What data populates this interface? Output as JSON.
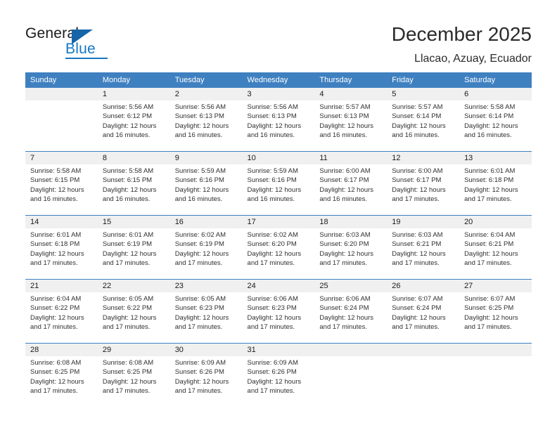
{
  "brand": {
    "name_part1": "General",
    "name_part2": "Blue",
    "flag_color": "#1565a8",
    "accent_color": "#1577c4"
  },
  "header": {
    "title": "December 2025",
    "subtitle": "Llacao, Azuay, Ecuador"
  },
  "calendar": {
    "header_bg": "#3f80c0",
    "numbers_row_bg": "#f0f0f0",
    "weekdays": [
      "Sunday",
      "Monday",
      "Tuesday",
      "Wednesday",
      "Thursday",
      "Friday",
      "Saturday"
    ],
    "weeks": [
      [
        {
          "day": "",
          "sunrise": "",
          "sunset": "",
          "daylight1": "",
          "daylight2": ""
        },
        {
          "day": "1",
          "sunrise": "Sunrise: 5:56 AM",
          "sunset": "Sunset: 6:12 PM",
          "daylight1": "Daylight: 12 hours",
          "daylight2": "and 16 minutes."
        },
        {
          "day": "2",
          "sunrise": "Sunrise: 5:56 AM",
          "sunset": "Sunset: 6:13 PM",
          "daylight1": "Daylight: 12 hours",
          "daylight2": "and 16 minutes."
        },
        {
          "day": "3",
          "sunrise": "Sunrise: 5:56 AM",
          "sunset": "Sunset: 6:13 PM",
          "daylight1": "Daylight: 12 hours",
          "daylight2": "and 16 minutes."
        },
        {
          "day": "4",
          "sunrise": "Sunrise: 5:57 AM",
          "sunset": "Sunset: 6:13 PM",
          "daylight1": "Daylight: 12 hours",
          "daylight2": "and 16 minutes."
        },
        {
          "day": "5",
          "sunrise": "Sunrise: 5:57 AM",
          "sunset": "Sunset: 6:14 PM",
          "daylight1": "Daylight: 12 hours",
          "daylight2": "and 16 minutes."
        },
        {
          "day": "6",
          "sunrise": "Sunrise: 5:58 AM",
          "sunset": "Sunset: 6:14 PM",
          "daylight1": "Daylight: 12 hours",
          "daylight2": "and 16 minutes."
        }
      ],
      [
        {
          "day": "7",
          "sunrise": "Sunrise: 5:58 AM",
          "sunset": "Sunset: 6:15 PM",
          "daylight1": "Daylight: 12 hours",
          "daylight2": "and 16 minutes."
        },
        {
          "day": "8",
          "sunrise": "Sunrise: 5:58 AM",
          "sunset": "Sunset: 6:15 PM",
          "daylight1": "Daylight: 12 hours",
          "daylight2": "and 16 minutes."
        },
        {
          "day": "9",
          "sunrise": "Sunrise: 5:59 AM",
          "sunset": "Sunset: 6:16 PM",
          "daylight1": "Daylight: 12 hours",
          "daylight2": "and 16 minutes."
        },
        {
          "day": "10",
          "sunrise": "Sunrise: 5:59 AM",
          "sunset": "Sunset: 6:16 PM",
          "daylight1": "Daylight: 12 hours",
          "daylight2": "and 16 minutes."
        },
        {
          "day": "11",
          "sunrise": "Sunrise: 6:00 AM",
          "sunset": "Sunset: 6:17 PM",
          "daylight1": "Daylight: 12 hours",
          "daylight2": "and 16 minutes."
        },
        {
          "day": "12",
          "sunrise": "Sunrise: 6:00 AM",
          "sunset": "Sunset: 6:17 PM",
          "daylight1": "Daylight: 12 hours",
          "daylight2": "and 17 minutes."
        },
        {
          "day": "13",
          "sunrise": "Sunrise: 6:01 AM",
          "sunset": "Sunset: 6:18 PM",
          "daylight1": "Daylight: 12 hours",
          "daylight2": "and 17 minutes."
        }
      ],
      [
        {
          "day": "14",
          "sunrise": "Sunrise: 6:01 AM",
          "sunset": "Sunset: 6:18 PM",
          "daylight1": "Daylight: 12 hours",
          "daylight2": "and 17 minutes."
        },
        {
          "day": "15",
          "sunrise": "Sunrise: 6:01 AM",
          "sunset": "Sunset: 6:19 PM",
          "daylight1": "Daylight: 12 hours",
          "daylight2": "and 17 minutes."
        },
        {
          "day": "16",
          "sunrise": "Sunrise: 6:02 AM",
          "sunset": "Sunset: 6:19 PM",
          "daylight1": "Daylight: 12 hours",
          "daylight2": "and 17 minutes."
        },
        {
          "day": "17",
          "sunrise": "Sunrise: 6:02 AM",
          "sunset": "Sunset: 6:20 PM",
          "daylight1": "Daylight: 12 hours",
          "daylight2": "and 17 minutes."
        },
        {
          "day": "18",
          "sunrise": "Sunrise: 6:03 AM",
          "sunset": "Sunset: 6:20 PM",
          "daylight1": "Daylight: 12 hours",
          "daylight2": "and 17 minutes."
        },
        {
          "day": "19",
          "sunrise": "Sunrise: 6:03 AM",
          "sunset": "Sunset: 6:21 PM",
          "daylight1": "Daylight: 12 hours",
          "daylight2": "and 17 minutes."
        },
        {
          "day": "20",
          "sunrise": "Sunrise: 6:04 AM",
          "sunset": "Sunset: 6:21 PM",
          "daylight1": "Daylight: 12 hours",
          "daylight2": "and 17 minutes."
        }
      ],
      [
        {
          "day": "21",
          "sunrise": "Sunrise: 6:04 AM",
          "sunset": "Sunset: 6:22 PM",
          "daylight1": "Daylight: 12 hours",
          "daylight2": "and 17 minutes."
        },
        {
          "day": "22",
          "sunrise": "Sunrise: 6:05 AM",
          "sunset": "Sunset: 6:22 PM",
          "daylight1": "Daylight: 12 hours",
          "daylight2": "and 17 minutes."
        },
        {
          "day": "23",
          "sunrise": "Sunrise: 6:05 AM",
          "sunset": "Sunset: 6:23 PM",
          "daylight1": "Daylight: 12 hours",
          "daylight2": "and 17 minutes."
        },
        {
          "day": "24",
          "sunrise": "Sunrise: 6:06 AM",
          "sunset": "Sunset: 6:23 PM",
          "daylight1": "Daylight: 12 hours",
          "daylight2": "and 17 minutes."
        },
        {
          "day": "25",
          "sunrise": "Sunrise: 6:06 AM",
          "sunset": "Sunset: 6:24 PM",
          "daylight1": "Daylight: 12 hours",
          "daylight2": "and 17 minutes."
        },
        {
          "day": "26",
          "sunrise": "Sunrise: 6:07 AM",
          "sunset": "Sunset: 6:24 PM",
          "daylight1": "Daylight: 12 hours",
          "daylight2": "and 17 minutes."
        },
        {
          "day": "27",
          "sunrise": "Sunrise: 6:07 AM",
          "sunset": "Sunset: 6:25 PM",
          "daylight1": "Daylight: 12 hours",
          "daylight2": "and 17 minutes."
        }
      ],
      [
        {
          "day": "28",
          "sunrise": "Sunrise: 6:08 AM",
          "sunset": "Sunset: 6:25 PM",
          "daylight1": "Daylight: 12 hours",
          "daylight2": "and 17 minutes."
        },
        {
          "day": "29",
          "sunrise": "Sunrise: 6:08 AM",
          "sunset": "Sunset: 6:25 PM",
          "daylight1": "Daylight: 12 hours",
          "daylight2": "and 17 minutes."
        },
        {
          "day": "30",
          "sunrise": "Sunrise: 6:09 AM",
          "sunset": "Sunset: 6:26 PM",
          "daylight1": "Daylight: 12 hours",
          "daylight2": "and 17 minutes."
        },
        {
          "day": "31",
          "sunrise": "Sunrise: 6:09 AM",
          "sunset": "Sunset: 6:26 PM",
          "daylight1": "Daylight: 12 hours",
          "daylight2": "and 17 minutes."
        },
        {
          "day": "",
          "sunrise": "",
          "sunset": "",
          "daylight1": "",
          "daylight2": ""
        },
        {
          "day": "",
          "sunrise": "",
          "sunset": "",
          "daylight1": "",
          "daylight2": ""
        },
        {
          "day": "",
          "sunrise": "",
          "sunset": "",
          "daylight1": "",
          "daylight2": ""
        }
      ]
    ]
  }
}
